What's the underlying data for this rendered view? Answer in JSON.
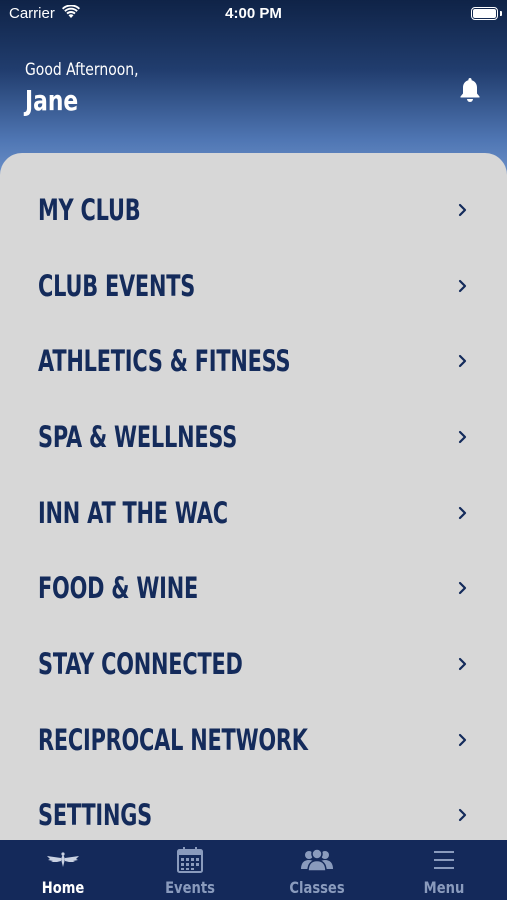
{
  "status_bar": {
    "carrier": "Carrier",
    "time": "4:00 PM"
  },
  "header": {
    "greeting": "Good Afternoon,",
    "user_name": "Jane",
    "notification_icon": "bell-icon"
  },
  "menu": {
    "items": [
      {
        "label": "MY CLUB"
      },
      {
        "label": "CLUB EVENTS"
      },
      {
        "label": "ATHLETICS & FITNESS"
      },
      {
        "label": "SPA & WELLNESS"
      },
      {
        "label": "INN AT THE WAC"
      },
      {
        "label": "FOOD & WINE"
      },
      {
        "label": "STAY CONNECTED"
      },
      {
        "label": "RECIPROCAL NETWORK"
      },
      {
        "label": "SETTINGS"
      }
    ]
  },
  "tab_bar": {
    "tabs": [
      {
        "label": "Home",
        "icon": "winged-logo-icon",
        "active": true
      },
      {
        "label": "Events",
        "icon": "calendar-icon",
        "active": false
      },
      {
        "label": "Classes",
        "icon": "people-icon",
        "active": false
      },
      {
        "label": "Menu",
        "icon": "hamburger-icon",
        "active": false
      }
    ]
  },
  "colors": {
    "navy": "#142b5b",
    "card_gray": "#d7d7d7",
    "inactive_tab": "#8a9bbd"
  }
}
